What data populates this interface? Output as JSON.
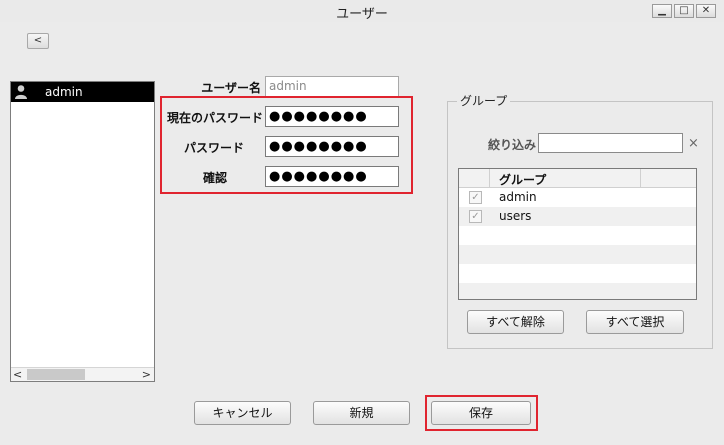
{
  "window": {
    "title": "ユーザー",
    "controls": [
      "minimize-icon",
      "maximize-icon",
      "close-icon"
    ]
  },
  "back_button": {
    "icon": "chevron-left-icon",
    "glyph": "<"
  },
  "user_list": {
    "items": [
      {
        "label": "admin",
        "icon": "user-icon",
        "selected": true
      }
    ],
    "scrollbar": {
      "left": "<",
      "right": ">"
    }
  },
  "form": {
    "username_label": "ユーザー名",
    "username_value": "admin",
    "current_password_label": "現在のパスワード",
    "current_password_value": "●●●●●●●●",
    "password_label": "パスワード",
    "password_value": "●●●●●●●●",
    "confirm_label": "確認",
    "confirm_value": "●●●●●●●●"
  },
  "group_panel": {
    "title": "グループ",
    "filter_label": "絞り込み",
    "filter_value": "",
    "filter_clear": "×",
    "table_header": "グループ",
    "groups": [
      {
        "name": "admin",
        "checked": true
      },
      {
        "name": "users",
        "checked": true
      }
    ],
    "deselect_all_label": "すべて解除",
    "select_all_label": "すべて選択"
  },
  "footer": {
    "cancel_label": "キャンセル",
    "new_label": "新規",
    "save_label": "保存"
  },
  "colors": {
    "highlight": "#e0242f",
    "selected_row_bg": "#000000",
    "window_bg": "#ebebeb"
  }
}
